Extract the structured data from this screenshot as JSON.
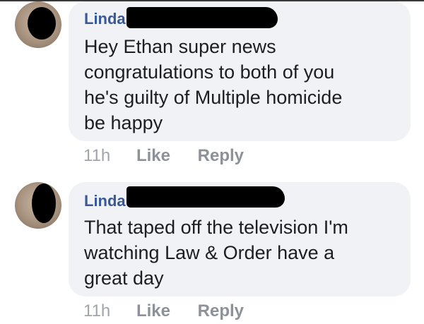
{
  "comments": [
    {
      "author": "Linda",
      "text": "Hey Ethan super news\ncongratulations to both of you\nhe's guilty of Multiple homicide\nbe happy",
      "time": "11h",
      "like_label": "Like",
      "reply_label": "Reply"
    },
    {
      "author": "Linda",
      "text": "That taped off the television I'm\nwatching Law & Order have a\ngreat day",
      "time": "11h",
      "like_label": "Like",
      "reply_label": "Reply"
    }
  ],
  "colors": {
    "author_link": "#385898",
    "bubble_bg": "#f0f2f5",
    "body_text": "#1c1e21",
    "action_text": "#90949c",
    "redaction": "#000000"
  }
}
